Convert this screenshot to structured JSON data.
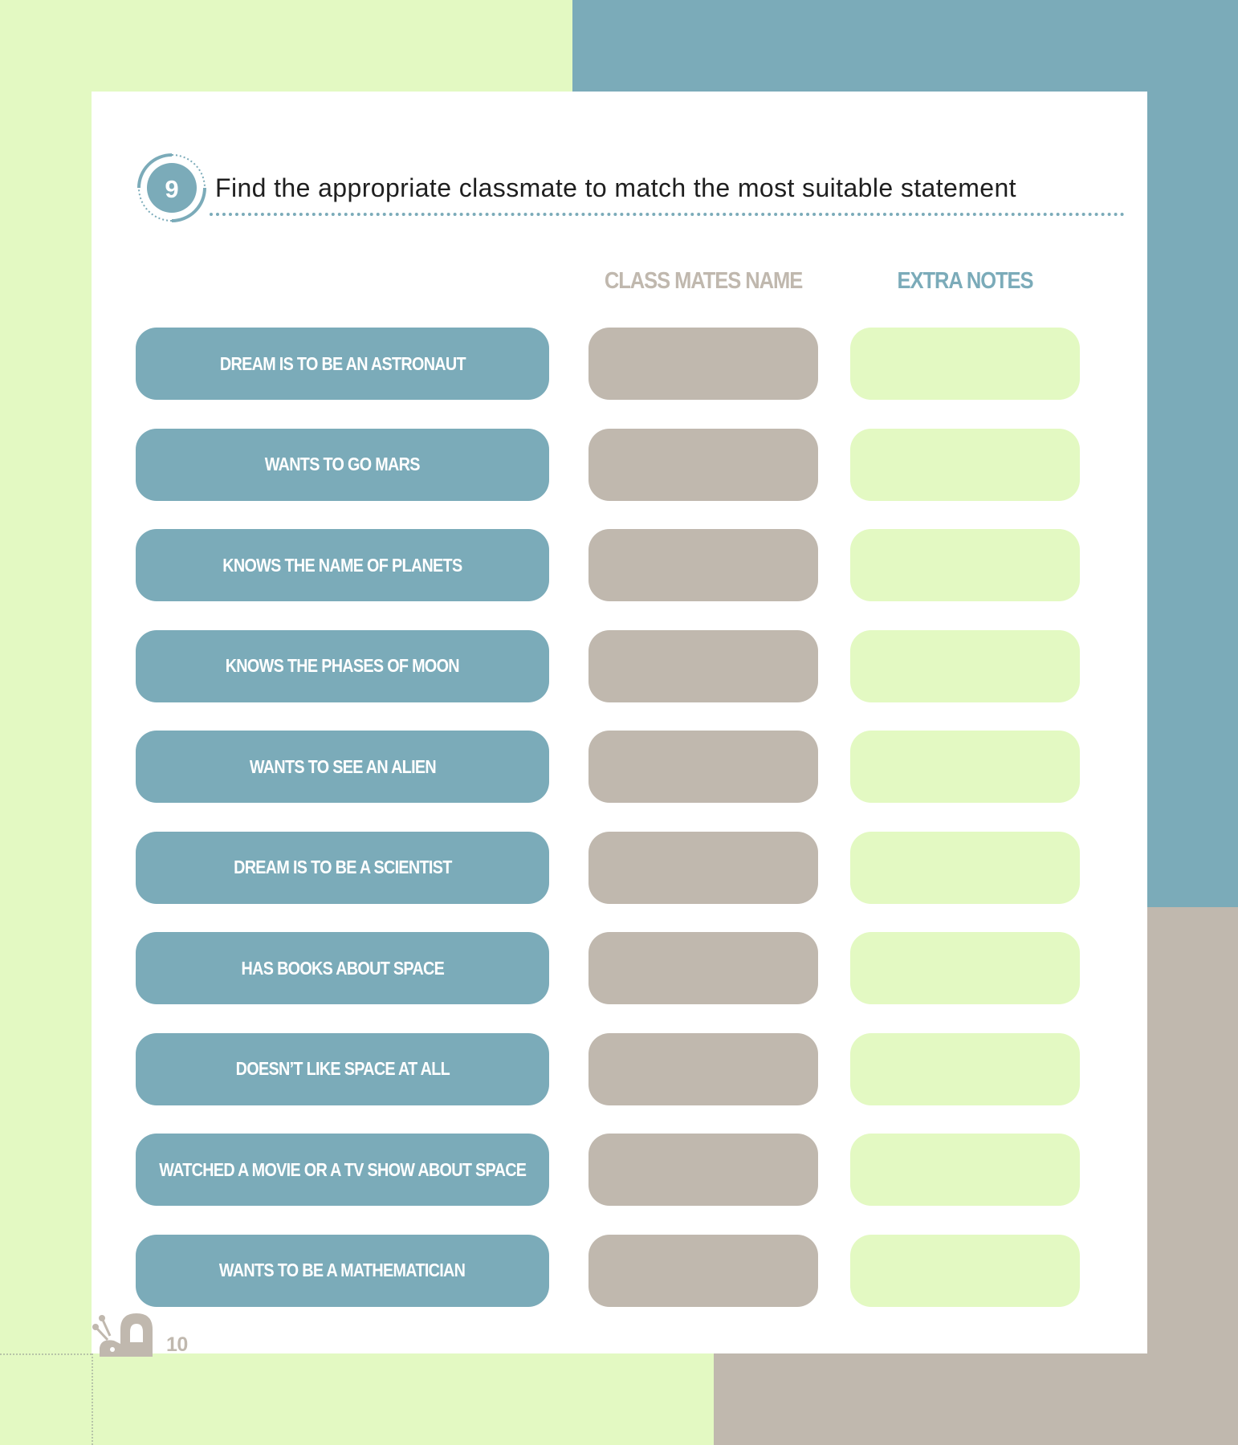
{
  "exercise": {
    "number": "9",
    "title": "Find the appropriate classmate to match the most suitable statement"
  },
  "columns": {
    "classmates_name": "CLASS MATES NAME",
    "extra_notes": "EXTRA NOTES"
  },
  "statements": [
    "DREAM IS TO BE AN ASTRONAUT",
    "WANTS TO GO MARS",
    "KNOWS THE NAME OF PLANETS",
    "KNOWS THE PHASES OF MOON",
    "WANTS TO SEE AN ALIEN",
    "DREAM IS TO BE A SCIENTIST",
    "HAS BOOKS ABOUT SPACE",
    "DOESN’T LIKE SPACE AT ALL",
    "WATCHED A MOVIE OR A TV SHOW ABOUT SPACE",
    "WANTS TO BE A MATHEMATICIAN"
  ],
  "page_number": "10",
  "colors": {
    "blue": "#7babb9",
    "taupe": "#c0b8ae",
    "light_green": "#e3f9c2"
  },
  "icons": {
    "badge": "number-badge-icon",
    "footer": "snail-icon"
  }
}
